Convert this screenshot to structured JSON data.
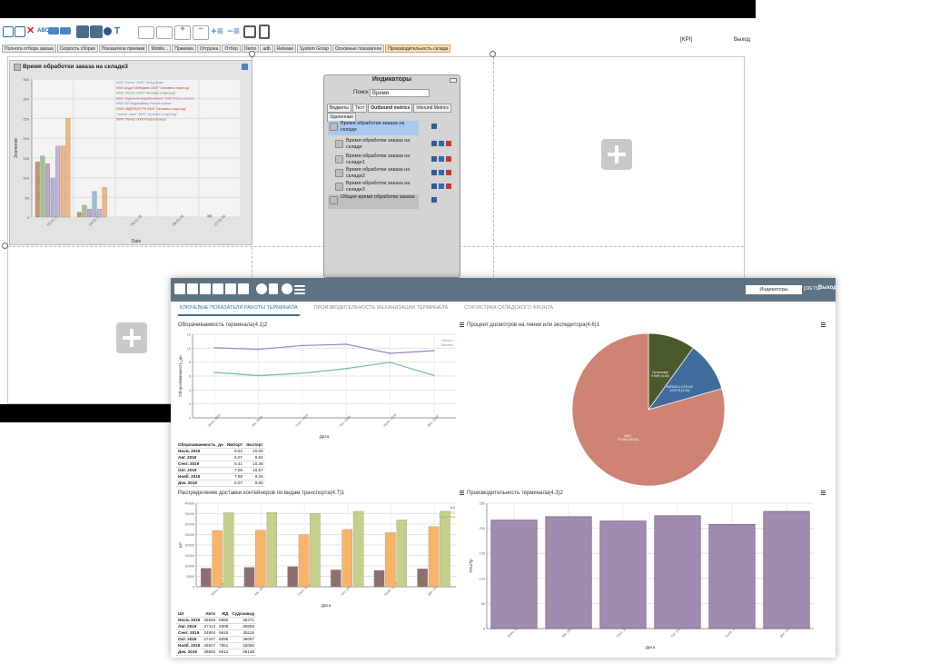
{
  "back": {
    "toolbar": {
      "kpi": "[KPI]",
      "exit": "Выход"
    },
    "tabs": [
      "Полнота отбора заказа",
      "Скорость сборки",
      "Показатели приемки",
      "Mobile...",
      "Приемка",
      "Отгрузка",
      "Отбор",
      "Demo",
      "adb",
      "Release",
      "System Group",
      "Основные показатели",
      "Производительность склада"
    ],
    "active_tab": "Производительность склада",
    "widget": {
      "title": "Время обработки заказа на складе3"
    },
    "widget_chart": {
      "type": "bar",
      "ylabel": "Значение",
      "xlabel": "Date",
      "yticks": [
        "350",
        "300",
        "250",
        "200",
        "150",
        "100",
        "50",
        "0"
      ],
      "ylim": [
        0,
        350
      ],
      "categories": [
        "02.01.16",
        "04.01.16",
        "05.01.16",
        "06.01.16",
        "07.01.16"
      ],
      "legend": [
        "0000 \"Лента\" 0000 \"Чебурашка\"",
        "0000 АндрЛ Лебедево 0000 \"Человек и пароход\"",
        "0000 \"Лента\" 0000 \"Человек и пароход\"",
        "0000 \"Будиный Индийсковыми\" 0000 Роса в колесе",
        "0000 ОЛ Моделайнер Роса в колесе",
        "0000 ОВДРЕЮЛ РЯ 0000 \"Человек и пароход\"",
        "\"знаете лимо\" 0000 \"Человек и пароход\"",
        "0000 \"Лента\" 0000 Роса в колесе"
      ],
      "series": [
        {
          "color": "#c4946e",
          "values": [
            140,
            12,
            0,
            0,
            0
          ]
        },
        {
          "color": "#9bc58c",
          "values": [
            155,
            30,
            0,
            0,
            5
          ]
        },
        {
          "color": "#c4a4c4",
          "values": [
            135,
            20,
            0,
            0,
            0
          ]
        },
        {
          "color": "#9fb8d6",
          "values": [
            98,
            65,
            0,
            0,
            0
          ]
        },
        {
          "color": "#c6b4d6",
          "values": [
            180,
            20,
            0,
            0,
            0
          ]
        },
        {
          "color": "#f3b57f",
          "values": [
            180,
            75,
            0,
            0,
            0
          ]
        },
        {
          "color": "#f3b57f",
          "values": [
            250,
            0,
            0,
            0,
            0
          ]
        }
      ]
    },
    "indicators": {
      "title": "Индикаторы",
      "search_label": "Поиск",
      "search_value": "Время",
      "tabs": [
        "Виджеты",
        "Тест",
        "Outbound metrics",
        "Inbound Metrics"
      ],
      "delete_label": "Удаленные",
      "items": [
        {
          "label": "Время обработки заказа на складе",
          "selected": true
        },
        {
          "label": "Время обработки заказа на складе",
          "selected": false
        },
        {
          "label": "Время обработки заказа на складе1",
          "selected": false
        },
        {
          "label": "Время обработки заказа на складе2",
          "selected": false
        },
        {
          "label": "Время обработки заказа на складе3",
          "selected": false
        },
        {
          "label": "Общее время обработки заказа",
          "selected": false
        }
      ]
    }
  },
  "front": {
    "header": {
      "indicators_btn": "Индикаторы",
      "user": "[DIETS]",
      "exit": "Выход"
    },
    "tabs": [
      "КЛЮЧЕВЫЕ ПОКАЗАТЕЛИ РАБОТЫ ТЕРМИНАЛА",
      "ПРОИЗВОДИТЕЛЬНОСТЬ МЕХАНИЗАЦИИ ТЕРМИНАЛА",
      "СТАТИСТИКА СКЛАДСКОГО ФРОНТА"
    ],
    "active_tab": "КЛЮЧЕВЫЕ ПОКАЗАТЕЛИ РАБОТЫ ТЕРМИНАЛА",
    "panel1": {
      "title": "Оборачиваемость терминала(4.1)2"
    },
    "panel2": {
      "title": "Процент досмотров на линии или экспедитора(4.6)1"
    },
    "panel3": {
      "title": "Распределение доставки контейнеров по видам транспорта(4.7)1"
    },
    "panel4": {
      "title": "Производительность терминала(4.3)2"
    },
    "table1": {
      "headers": [
        "Оборачиваемость_дн",
        "Импорт",
        "Экспорт"
      ],
      "rows": [
        [
          "Июль 2019",
          "6.52",
          "10.06"
        ],
        [
          "Авг. 2019",
          "6.07",
          "9.84"
        ],
        [
          "Сент. 2019",
          "6.41",
          "10.38"
        ],
        [
          "Окт. 2019",
          "7.08",
          "10.57"
        ],
        [
          "Нояб. 2019",
          "7.98",
          "9.26"
        ],
        [
          "Дек. 2019",
          "6.07",
          "9.65"
        ]
      ]
    },
    "table3": {
      "headers": [
        "Шт",
        "Авто",
        "ЖД",
        "Судозавод"
      ],
      "rows": [
        [
          "Июль 2019",
          "26946",
          "8880",
          "35471"
        ],
        [
          "Авг. 2019",
          "27113",
          "9309",
          "35606"
        ],
        [
          "Сент. 2019",
          "24904",
          "9616",
          "35115"
        ],
        [
          "Окт. 2019",
          "27447",
          "8095",
          "36097"
        ],
        [
          "Нояб. 2019",
          "25927",
          "7851",
          "32090"
        ],
        [
          "Дек. 2019",
          "28862",
          "8612",
          "36138"
        ]
      ]
    }
  },
  "chart_data": [
    {
      "type": "line",
      "title": "Оборачиваемость терминала(4.1)2",
      "xlabel": "Дата",
      "ylabel": "Оборачиваемость_дн",
      "categories": [
        "Июль 2019",
        "Авг. 2019",
        "Сент. 2019",
        "Окт. 2019",
        "Нояб. 2019",
        "Дек. 2019"
      ],
      "yticks": [
        "12",
        "10",
        "8",
        "6",
        "4",
        "2",
        "0"
      ],
      "ylim": [
        0,
        12
      ],
      "series": [
        {
          "name": "Импорт",
          "color": "#6fbfa0",
          "values": [
            6.52,
            6.07,
            6.41,
            7.08,
            7.98,
            6.07
          ]
        },
        {
          "name": "Экспорт",
          "color": "#8e88c2",
          "values": [
            10.06,
            9.84,
            10.38,
            10.57,
            9.26,
            9.65
          ]
        }
      ]
    },
    {
      "type": "pie",
      "title": "Процент досмотров на линии или экспедитора(4.6)1",
      "slices": [
        {
          "label": "MSC",
          "pct_text": "79.45% (36.83)",
          "value": 79.45,
          "color": "#cd8274"
        },
        {
          "label": "HAPAG-LLOYD AG",
          "pct_text": "10.57% (4.90)",
          "value": 10.57,
          "color": "#3f6b9d"
        },
        {
          "label": "Остальные",
          "pct_text": "9.98% (4.63)",
          "value": 9.98,
          "color": "#4a5a2c"
        }
      ]
    },
    {
      "type": "bar",
      "title": "Распределение доставки контейнеров по видам транспорта(4.7)1",
      "xlabel": "Дата",
      "ylabel": "Шт",
      "categories": [
        "Июль 2019",
        "Авг. 2019",
        "Сент. 2019",
        "Окт. 2019",
        "Нояб. 2019",
        "Дек. 2019"
      ],
      "yticks": [
        "40000",
        "35000",
        "30000",
        "25000",
        "20000",
        "15000",
        "10000",
        "5000",
        "0"
      ],
      "ylim": [
        0,
        40000
      ],
      "series": [
        {
          "name": "ЖД",
          "color": "#8e6f6b",
          "values": [
            8880,
            9309,
            9616,
            8095,
            7851,
            8612
          ]
        },
        {
          "name": "Авто",
          "color": "#f7b36a",
          "values": [
            26946,
            27113,
            24904,
            27447,
            25927,
            28862
          ]
        },
        {
          "name": "Судозавод",
          "color": "#c5cf8c",
          "values": [
            35471,
            35606,
            35115,
            36097,
            32090,
            36138
          ]
        }
      ]
    },
    {
      "type": "bar",
      "title": "Производительность терминала(4.3)2",
      "xlabel": "Дата",
      "ylabel": "TEU/Тр",
      "categories": [
        "Июль 2019",
        "Авг. 2019",
        "Сент. 2019",
        "Окт. 2019",
        "Нояб. 2019",
        "Дек. 2019"
      ],
      "yticks": [
        "250",
        "200",
        "150",
        "100",
        "50",
        "0"
      ],
      "ylim": [
        0,
        260
      ],
      "series": [
        {
          "color": "#a28bb0",
          "values": [
            225,
            232,
            223,
            234,
            216,
            243
          ]
        }
      ]
    }
  ]
}
